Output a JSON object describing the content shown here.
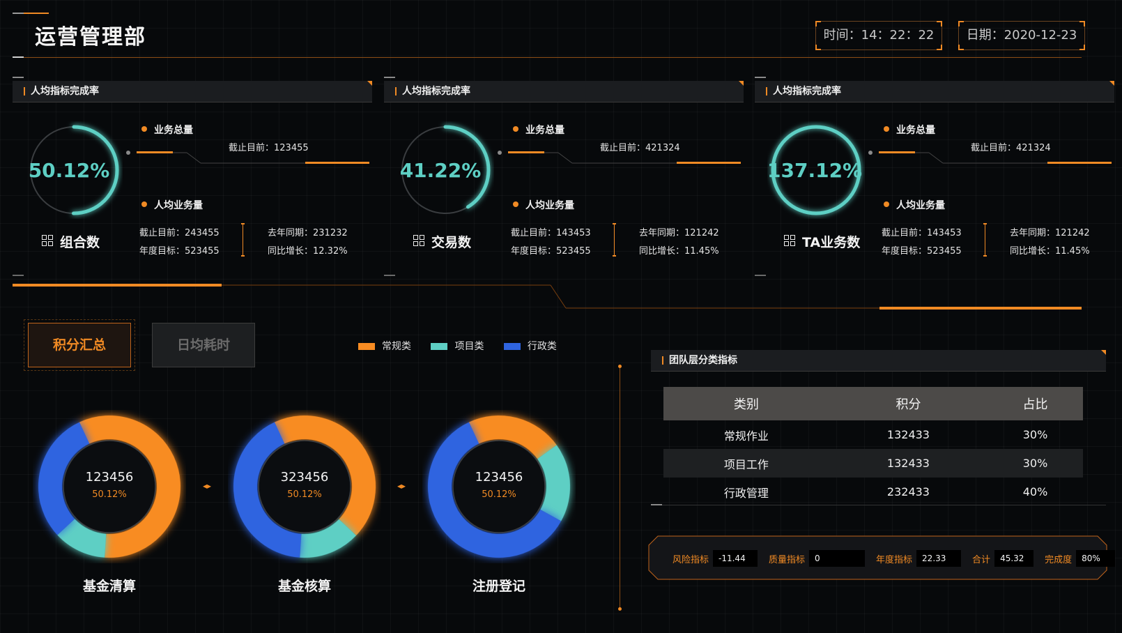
{
  "header": {
    "title": "运营管理部",
    "time_text": "时间：14：22：22",
    "date_text": "日期：2020-12-23"
  },
  "kpi_panels": [
    {
      "header": "人均指标完成率",
      "percent": "50.12%",
      "ring_fraction": 0.5012,
      "name": "组合数",
      "total_label": "业务总量",
      "total_value": "截止目前：123455",
      "per_label": "人均业务量",
      "as_of": "截止目前：243455",
      "annual_target": "年度目标：523455",
      "last_year": "去年同期：231232",
      "yoy_growth": "同比增长：12.32%"
    },
    {
      "header": "人均指标完成率",
      "percent": "41.22%",
      "ring_fraction": 0.4122,
      "name": "交易数",
      "total_label": "业务总量",
      "total_value": "截止目前：421324",
      "per_label": "人均业务量",
      "as_of": "截止目前：143453",
      "annual_target": "年度目标：523455",
      "last_year": "去年同期：121242",
      "yoy_growth": "同比增长：11.45%"
    },
    {
      "header": "人均指标完成率",
      "percent": "137.12%",
      "ring_fraction": 1.0,
      "name": "TA业务数",
      "total_label": "业务总量",
      "total_value": "截止目前：421324",
      "per_label": "人均业务量",
      "as_of": "截止目前：143453",
      "annual_target": "年度目标：523455",
      "last_year": "去年同期：121242",
      "yoy_growth": "同比增长：11.45%"
    }
  ],
  "tabs": {
    "active": "积分汇总",
    "inactive": "日均耗时"
  },
  "legend": [
    {
      "label": "常规类",
      "color": "#f88c22"
    },
    {
      "label": "项目类",
      "color": "#5ecfc4"
    },
    {
      "label": "行政类",
      "color": "#2f64e0"
    }
  ],
  "donuts": [
    {
      "value": "123456",
      "percent": "50.12%",
      "name": "基金清算",
      "segments": [
        0.58,
        0.12,
        0.3
      ]
    },
    {
      "value": "323456",
      "percent": "50.12%",
      "name": "基金核算",
      "segments": [
        0.44,
        0.14,
        0.42
      ]
    },
    {
      "value": "123456",
      "percent": "50.12%",
      "name": "注册登记",
      "segments": [
        0.22,
        0.18,
        0.6
      ]
    }
  ],
  "team_panel": {
    "header": "团队层分类指标",
    "columns": [
      "类别",
      "积分",
      "占比"
    ],
    "rows": [
      [
        "常规作业",
        "132433",
        "30%"
      ],
      [
        "项目工作",
        "132433",
        "30%"
      ],
      [
        "行政管理",
        "232433",
        "40%"
      ]
    ]
  },
  "stats": [
    {
      "label": "风险指标",
      "value": "-11.44"
    },
    {
      "label": "质量指标",
      "value": "0"
    },
    {
      "label": "年度指标",
      "value": "22.33"
    },
    {
      "label": "合计",
      "value": "45.32"
    },
    {
      "label": "完成度",
      "value": "80%"
    }
  ],
  "colors": {
    "accent": "#f08a24",
    "teal": "#5ecfc4",
    "blue": "#2f64e0",
    "background": "#07090b"
  }
}
